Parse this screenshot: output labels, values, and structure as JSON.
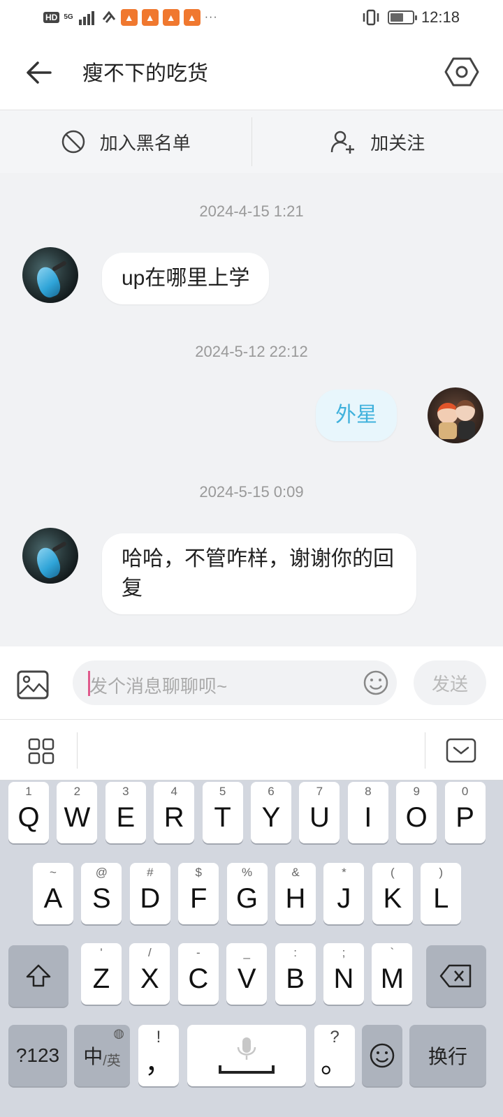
{
  "status_bar": {
    "hd": "HD",
    "net": "5G",
    "dots": "···",
    "time": "12:18"
  },
  "header": {
    "title": "瘦不下的吃货",
    "back_icon": "arrow-left-icon",
    "settings_icon": "hexagon-settings-icon"
  },
  "actions": {
    "block_label": "加入黑名单",
    "follow_label": "加关注"
  },
  "messages": [
    {
      "timestamp": "2024-4-15 1:21",
      "from": "other",
      "text": "up在哪里上学"
    },
    {
      "timestamp": "2024-5-12 22:12",
      "from": "me",
      "text": "外星"
    },
    {
      "timestamp": "2024-5-15 0:09",
      "from": "other",
      "text": "哈哈，不管咋样，谢谢你的回复"
    }
  ],
  "input": {
    "placeholder": "发个消息聊聊呗~",
    "send_label": "发送"
  },
  "keyboard": {
    "row1": [
      {
        "key": "Q",
        "sub": "1"
      },
      {
        "key": "W",
        "sub": "2"
      },
      {
        "key": "E",
        "sub": "3"
      },
      {
        "key": "R",
        "sub": "4"
      },
      {
        "key": "T",
        "sub": "5"
      },
      {
        "key": "Y",
        "sub": "6"
      },
      {
        "key": "U",
        "sub": "7"
      },
      {
        "key": "I",
        "sub": "8"
      },
      {
        "key": "O",
        "sub": "9"
      },
      {
        "key": "P",
        "sub": "0"
      }
    ],
    "row2": [
      {
        "key": "A",
        "sub": "~"
      },
      {
        "key": "S",
        "sub": "@"
      },
      {
        "key": "D",
        "sub": "#"
      },
      {
        "key": "F",
        "sub": "$"
      },
      {
        "key": "G",
        "sub": "%"
      },
      {
        "key": "H",
        "sub": "&"
      },
      {
        "key": "J",
        "sub": "*"
      },
      {
        "key": "K",
        "sub": "("
      },
      {
        "key": "L",
        "sub": ")"
      }
    ],
    "row3": [
      {
        "key": "Z",
        "sub": "'"
      },
      {
        "key": "X",
        "sub": "/"
      },
      {
        "key": "C",
        "sub": "-"
      },
      {
        "key": "V",
        "sub": "_"
      },
      {
        "key": "B",
        "sub": ":"
      },
      {
        "key": "N",
        "sub": ";"
      },
      {
        "key": "M",
        "sub": "`"
      }
    ],
    "numbers_label": "?123",
    "lang_main": "中",
    "lang_sub": "/英",
    "comma_key": "，",
    "comma_sub": "!",
    "period_key": "。",
    "period_sub": "?",
    "enter_label": "换行"
  },
  "colors": {
    "accent_blue": "#3fb1dc",
    "bubble_me_bg": "#e8f6fc",
    "chat_bg": "#f1f2f4",
    "caret": "#e05a8c"
  }
}
